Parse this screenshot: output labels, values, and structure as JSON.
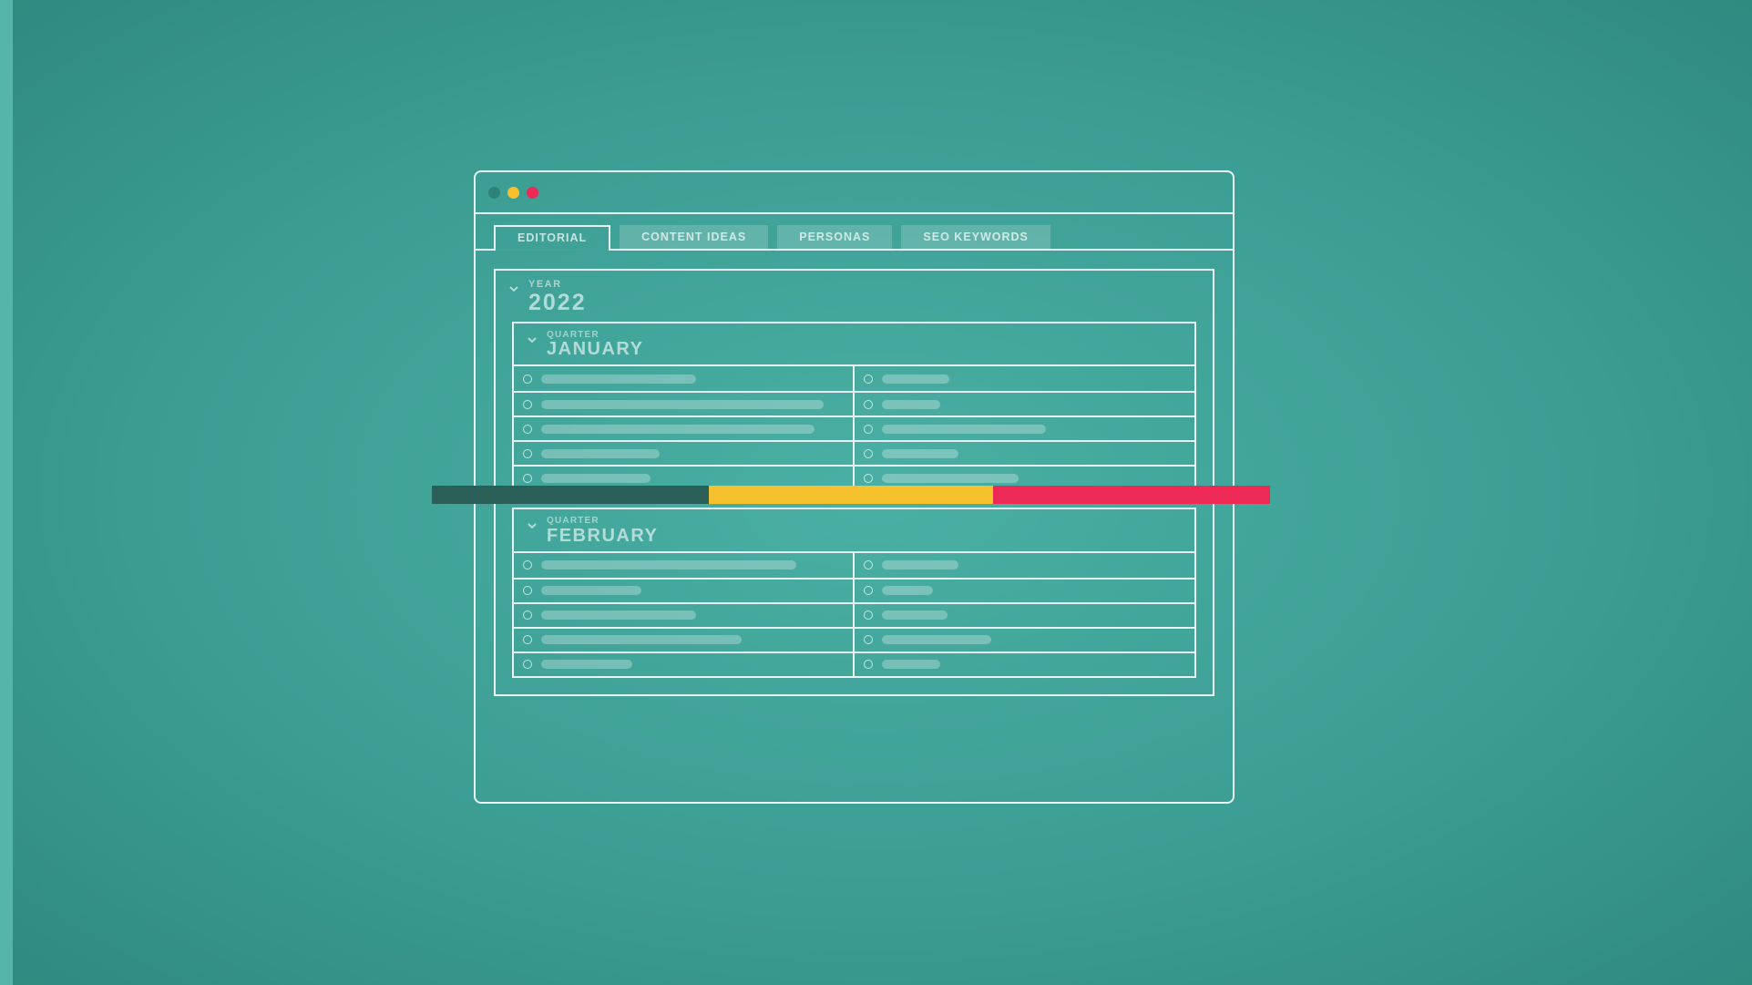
{
  "window": {
    "traffic_lights": [
      "#2f8278",
      "#f5c12e",
      "#ec2a55"
    ]
  },
  "tabs": [
    {
      "label": "EDITORIAL",
      "active": true
    },
    {
      "label": "CONTENT IDEAS",
      "active": false
    },
    {
      "label": "PERSONAS",
      "active": false
    },
    {
      "label": "SEO KEYWORDS",
      "active": false
    }
  ],
  "year": {
    "eyebrow": "YEAR",
    "value": "2022"
  },
  "months": [
    {
      "eyebrow": "QUARTER",
      "name": "JANUARY",
      "left_widths": [
        170,
        310,
        300,
        130,
        120
      ],
      "right_widths": [
        74,
        64,
        180,
        84,
        150
      ]
    },
    {
      "eyebrow": "QUARTER",
      "name": "FEBRUARY",
      "left_widths": [
        280,
        110,
        170,
        220,
        100
      ],
      "right_widths": [
        84,
        56,
        72,
        120,
        64
      ]
    }
  ],
  "progress": {
    "segments": [
      {
        "color": "#2a5f59",
        "width_pct": 33
      },
      {
        "color": "#f5c12e",
        "width_pct": 34
      },
      {
        "color": "#ec2a55",
        "width_pct": 33
      }
    ]
  }
}
